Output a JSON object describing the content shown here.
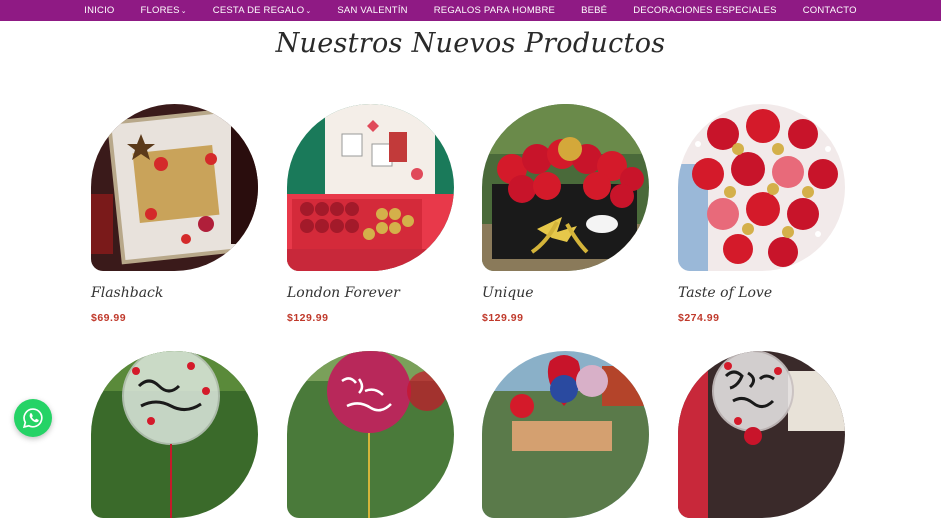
{
  "nav": {
    "items": [
      {
        "label": "INICIO",
        "has_dropdown": false
      },
      {
        "label": "FLORES",
        "has_dropdown": true
      },
      {
        "label": "CESTA DE REGALO",
        "has_dropdown": true
      },
      {
        "label": "SAN VALENTÍN",
        "has_dropdown": false
      },
      {
        "label": "REGALOS PARA HOMBRE",
        "has_dropdown": false
      },
      {
        "label": "BEBÉ",
        "has_dropdown": false
      },
      {
        "label": "DECORACIONES ESPECIALES",
        "has_dropdown": false
      },
      {
        "label": "CONTACTO",
        "has_dropdown": false
      }
    ],
    "caret": "⌄"
  },
  "section": {
    "title": "Nuestros Nuevos Productos"
  },
  "products": [
    {
      "name": "Flashback",
      "price": "$69.99"
    },
    {
      "name": "London Forever",
      "price": "$129.99"
    },
    {
      "name": "Unique",
      "price": "$129.99"
    },
    {
      "name": "Taste of Love",
      "price": "$274.99"
    },
    {
      "name": "",
      "price": ""
    },
    {
      "name": "",
      "price": ""
    },
    {
      "name": "",
      "price": ""
    },
    {
      "name": "",
      "price": ""
    }
  ],
  "colors": {
    "nav_bg": "#8f1a84",
    "price": "#c0392b",
    "whatsapp": "#25d366"
  },
  "icons": {
    "whatsapp": "whatsapp-icon"
  }
}
